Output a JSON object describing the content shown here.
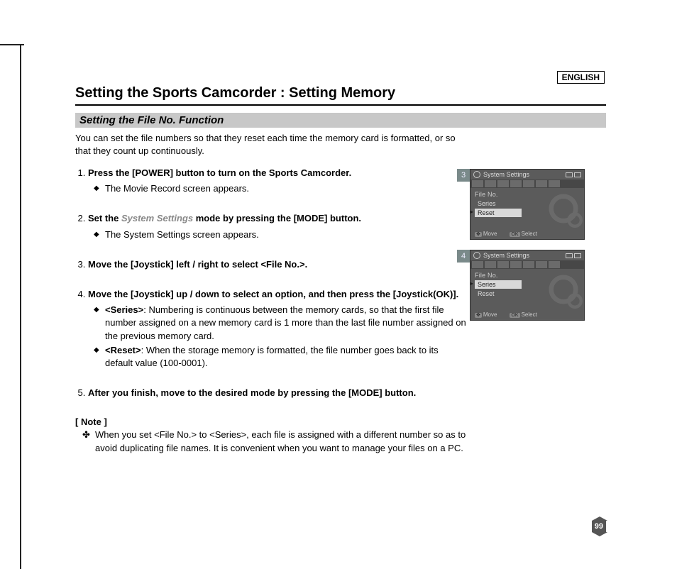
{
  "language": "ENGLISH",
  "page_title": "Setting the Sports Camcorder : Setting Memory",
  "section_title": "Setting the File No. Function",
  "intro": "You can set the file numbers so that they reset each time the memory card is formatted, or so that they count up continuously.",
  "steps": [
    {
      "title_pre": "Press the [POWER] button to turn on the Sports Camcorder.",
      "bullets": [
        "The Movie Record screen appears."
      ]
    },
    {
      "title_pre": "Set the ",
      "title_em": "System Settings",
      "title_post": " mode by pressing the [MODE] button.",
      "bullets": [
        "The System Settings screen appears."
      ]
    },
    {
      "title_pre": "Move the [Joystick] left / right to select <File No.>.",
      "bullets": []
    },
    {
      "title_pre": "Move the [Joystick] up / down to select an option, and then press the [Joystick(OK)].",
      "options": [
        {
          "name": "<Series>",
          "desc": ": Numbering is continuous between the memory cards, so that the first file number assigned on a new memory card is 1 more than the last file number assigned on the previous memory card."
        },
        {
          "name": "<Reset>",
          "desc": ": When the storage memory is formatted, the file number goes back to its default value (100-0001)."
        }
      ]
    },
    {
      "title_pre": "After you finish, move to the desired mode by pressing the [MODE] button.",
      "bullets": []
    }
  ],
  "note_heading": "[ Note ]",
  "note_body": "When you set <File No.> to <Series>, each file is assigned with a different number so as to avoid duplicating file names. It is convenient when you want to manage your files on a PC.",
  "page_number": "99",
  "screens": [
    {
      "step": "3",
      "title": "System Settings",
      "menu_header": "File No.",
      "items": [
        {
          "label": "Series",
          "selected": false
        },
        {
          "label": "Reset",
          "selected": true
        }
      ],
      "footer_move": "Move",
      "footer_select": "Select",
      "footer_ok": "OK"
    },
    {
      "step": "4",
      "title": "System Settings",
      "menu_header": "File No.",
      "items": [
        {
          "label": "Series",
          "selected": true
        },
        {
          "label": "Reset",
          "selected": false
        }
      ],
      "footer_move": "Move",
      "footer_select": "Select",
      "footer_ok": "OK"
    }
  ]
}
